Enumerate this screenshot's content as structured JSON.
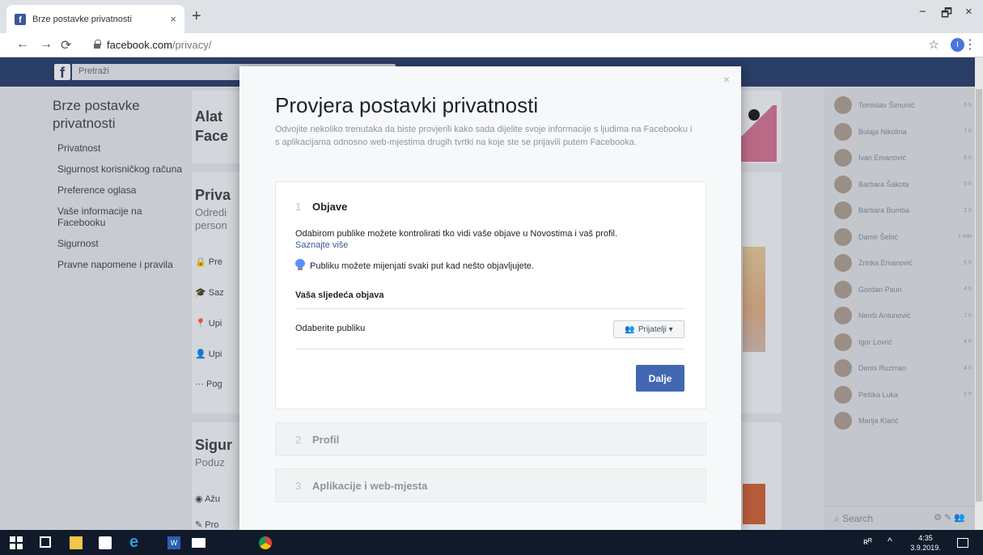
{
  "browser": {
    "tab_title": "Brze postavke privatnosti",
    "tab_close": "×",
    "new_tab": "+",
    "win_min": "−",
    "win_max": "🗗",
    "win_close": "×",
    "url_host": "facebook.com",
    "url_path": "/privacy/",
    "profile_initial": "I"
  },
  "fb": {
    "logo": "f",
    "search_placeholder": "Pretraži"
  },
  "left_nav": {
    "title": "Brze postavke privatnosti",
    "items": [
      "Privatnost",
      "Sigurnost korisničkog računa",
      "Preference oglasa",
      "Vaše informacije na Facebooku",
      "Sigurnost",
      "Pravne napomene i pravila"
    ]
  },
  "bg_cards": {
    "card1_title": "Alat Face",
    "card2_title": "Priva",
    "card2_sub": "Odredi person",
    "card2_rows": [
      "Pre",
      "Saz",
      "Upi",
      "Upi",
      "Pog"
    ],
    "card3_title": "Sigur",
    "card3_sub": "Poduz",
    "card3_rows": [
      "Ažu",
      "Pro"
    ]
  },
  "chat": {
    "contacts": [
      {
        "name": "Tomislav Šimunić",
        "time": "5 h"
      },
      {
        "name": "Bulaja Nikolina",
        "time": "7 h"
      },
      {
        "name": "Ivan Emanović",
        "time": "5 h"
      },
      {
        "name": "Barbara Šakota",
        "time": "5 h"
      },
      {
        "name": "Barbara Bumba",
        "time": "2 h"
      },
      {
        "name": "Damir Šebić",
        "time": "1 min"
      },
      {
        "name": "Zrinka Emanović",
        "time": "5 h"
      },
      {
        "name": "Gordan Paun",
        "time": "4 h"
      },
      {
        "name": "Nenši Antunović",
        "time": "7 h"
      },
      {
        "name": "Igor Lovrić",
        "time": "4 h"
      },
      {
        "name": "Denis Ruzman",
        "time": "4 h"
      },
      {
        "name": "Pešika Luka",
        "time": "5 h"
      },
      {
        "name": "Marija Klarić",
        "time": ""
      }
    ],
    "search": "Search"
  },
  "modal": {
    "close": "×",
    "title": "Provjera postavki privatnosti",
    "description": "Odvojite nekoliko trenutaka da biste provjerili kako sada dijelite svoje informacije s ljudima na Facebooku i s aplikacijama odnosno web-mjestima drugih tvrtki na koje ste se prijavili putem Facebooka.",
    "steps": [
      {
        "num": "1",
        "title": "Objave"
      },
      {
        "num": "2",
        "title": "Profil"
      },
      {
        "num": "3",
        "title": "Aplikacije i web-mjesta"
      }
    ],
    "step1": {
      "text": "Odabirom publike možete kontrolirati tko vidi vaše objave u Novostima i vaš profil.",
      "link": "Saznajte više",
      "tip": "Publiku možete mijenjati svaki put kad nešto objavljujete.",
      "next_post": "Vaša sljedeća objava",
      "audience_label": "Odaberite publiku",
      "audience_value": "Prijatelji ▾",
      "next_button": "Dalje"
    }
  },
  "taskbar": {
    "time": "4:35",
    "date": "3.9.2019."
  }
}
